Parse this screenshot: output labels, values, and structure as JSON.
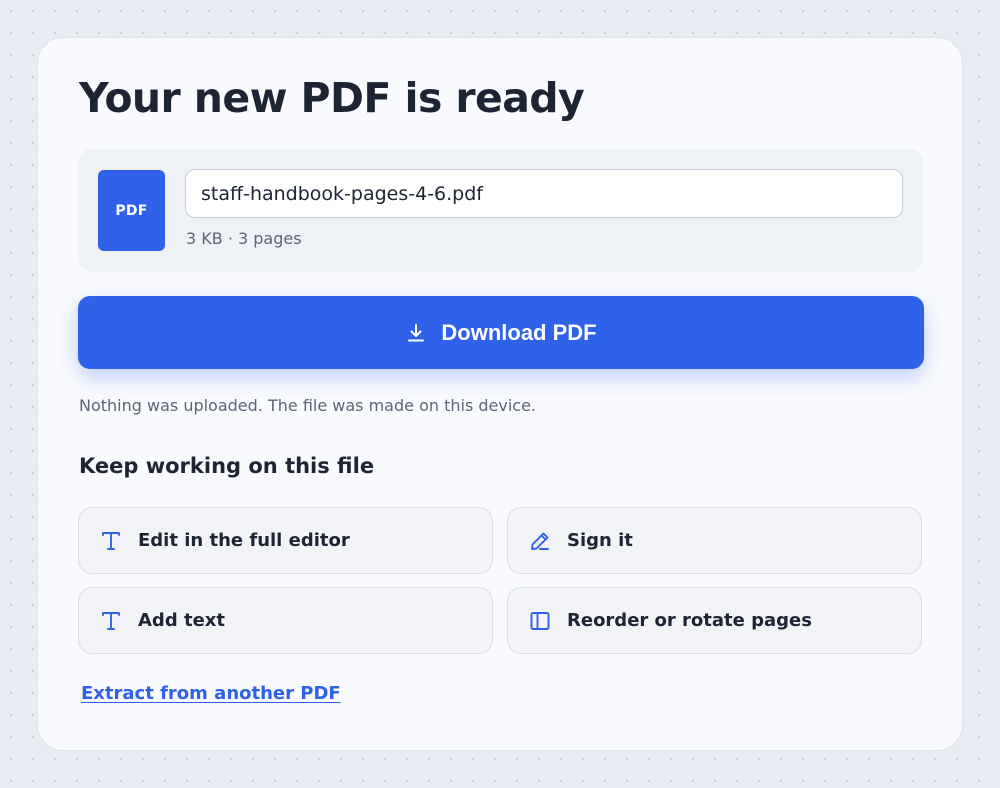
{
  "page": {
    "title": "Your new PDF is ready"
  },
  "file": {
    "badge_label": "PDF",
    "filename": "staff-handbook-pages-4-6.pdf",
    "meta": "3  KB · 3 pages"
  },
  "download": {
    "label": "Download PDF",
    "icon": "download-icon"
  },
  "privacy_note": "Nothing was uploaded. The file was made on this device.",
  "next_steps": {
    "heading": "Keep working on this file",
    "actions": [
      {
        "label": "Edit in the full editor",
        "icon": "text-icon"
      },
      {
        "label": "Sign it",
        "icon": "pen-icon"
      },
      {
        "label": "Add text",
        "icon": "text-icon"
      },
      {
        "label": "Reorder or rotate pages",
        "icon": "pages-panel-icon"
      }
    ]
  },
  "extract_link": "Extract from another PDF",
  "colors": {
    "accent": "#2f61e9",
    "background": "#e9ecf3",
    "card": "#f8fafd",
    "text": "#1d2535",
    "muted_text": "#5c6678"
  }
}
